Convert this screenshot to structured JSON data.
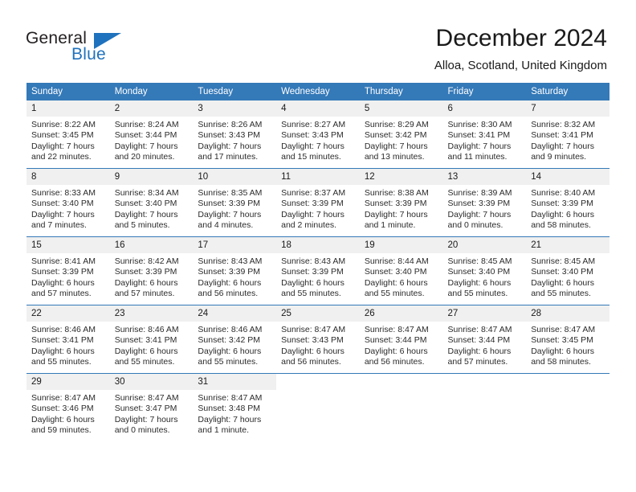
{
  "brand": {
    "name_top": "General",
    "name_bottom": "Blue",
    "triangle_color": "#1f72bd",
    "blue_text_color": "#1f72bd",
    "top_text_color": "#231f20"
  },
  "header": {
    "title": "December 2024",
    "subtitle": "Alloa, Scotland, United Kingdom"
  },
  "colors": {
    "header_row_bg": "#3479b8",
    "header_row_text": "#ffffff",
    "daynum_bg": "#f0f0f0",
    "week_divider": "#3479b8",
    "cell_bg": "#ffffff",
    "body_text": "#2b2b2b"
  },
  "weekday_headers": [
    "Sunday",
    "Monday",
    "Tuesday",
    "Wednesday",
    "Thursday",
    "Friday",
    "Saturday"
  ],
  "weeks": [
    [
      {
        "day": "1",
        "sunrise": "Sunrise: 8:22 AM",
        "sunset": "Sunset: 3:45 PM",
        "daylight_1": "Daylight: 7 hours",
        "daylight_2": "and 22 minutes."
      },
      {
        "day": "2",
        "sunrise": "Sunrise: 8:24 AM",
        "sunset": "Sunset: 3:44 PM",
        "daylight_1": "Daylight: 7 hours",
        "daylight_2": "and 20 minutes."
      },
      {
        "day": "3",
        "sunrise": "Sunrise: 8:26 AM",
        "sunset": "Sunset: 3:43 PM",
        "daylight_1": "Daylight: 7 hours",
        "daylight_2": "and 17 minutes."
      },
      {
        "day": "4",
        "sunrise": "Sunrise: 8:27 AM",
        "sunset": "Sunset: 3:43 PM",
        "daylight_1": "Daylight: 7 hours",
        "daylight_2": "and 15 minutes."
      },
      {
        "day": "5",
        "sunrise": "Sunrise: 8:29 AM",
        "sunset": "Sunset: 3:42 PM",
        "daylight_1": "Daylight: 7 hours",
        "daylight_2": "and 13 minutes."
      },
      {
        "day": "6",
        "sunrise": "Sunrise: 8:30 AM",
        "sunset": "Sunset: 3:41 PM",
        "daylight_1": "Daylight: 7 hours",
        "daylight_2": "and 11 minutes."
      },
      {
        "day": "7",
        "sunrise": "Sunrise: 8:32 AM",
        "sunset": "Sunset: 3:41 PM",
        "daylight_1": "Daylight: 7 hours",
        "daylight_2": "and 9 minutes."
      }
    ],
    [
      {
        "day": "8",
        "sunrise": "Sunrise: 8:33 AM",
        "sunset": "Sunset: 3:40 PM",
        "daylight_1": "Daylight: 7 hours",
        "daylight_2": "and 7 minutes."
      },
      {
        "day": "9",
        "sunrise": "Sunrise: 8:34 AM",
        "sunset": "Sunset: 3:40 PM",
        "daylight_1": "Daylight: 7 hours",
        "daylight_2": "and 5 minutes."
      },
      {
        "day": "10",
        "sunrise": "Sunrise: 8:35 AM",
        "sunset": "Sunset: 3:39 PM",
        "daylight_1": "Daylight: 7 hours",
        "daylight_2": "and 4 minutes."
      },
      {
        "day": "11",
        "sunrise": "Sunrise: 8:37 AM",
        "sunset": "Sunset: 3:39 PM",
        "daylight_1": "Daylight: 7 hours",
        "daylight_2": "and 2 minutes."
      },
      {
        "day": "12",
        "sunrise": "Sunrise: 8:38 AM",
        "sunset": "Sunset: 3:39 PM",
        "daylight_1": "Daylight: 7 hours",
        "daylight_2": "and 1 minute."
      },
      {
        "day": "13",
        "sunrise": "Sunrise: 8:39 AM",
        "sunset": "Sunset: 3:39 PM",
        "daylight_1": "Daylight: 7 hours",
        "daylight_2": "and 0 minutes."
      },
      {
        "day": "14",
        "sunrise": "Sunrise: 8:40 AM",
        "sunset": "Sunset: 3:39 PM",
        "daylight_1": "Daylight: 6 hours",
        "daylight_2": "and 58 minutes."
      }
    ],
    [
      {
        "day": "15",
        "sunrise": "Sunrise: 8:41 AM",
        "sunset": "Sunset: 3:39 PM",
        "daylight_1": "Daylight: 6 hours",
        "daylight_2": "and 57 minutes."
      },
      {
        "day": "16",
        "sunrise": "Sunrise: 8:42 AM",
        "sunset": "Sunset: 3:39 PM",
        "daylight_1": "Daylight: 6 hours",
        "daylight_2": "and 57 minutes."
      },
      {
        "day": "17",
        "sunrise": "Sunrise: 8:43 AM",
        "sunset": "Sunset: 3:39 PM",
        "daylight_1": "Daylight: 6 hours",
        "daylight_2": "and 56 minutes."
      },
      {
        "day": "18",
        "sunrise": "Sunrise: 8:43 AM",
        "sunset": "Sunset: 3:39 PM",
        "daylight_1": "Daylight: 6 hours",
        "daylight_2": "and 55 minutes."
      },
      {
        "day": "19",
        "sunrise": "Sunrise: 8:44 AM",
        "sunset": "Sunset: 3:40 PM",
        "daylight_1": "Daylight: 6 hours",
        "daylight_2": "and 55 minutes."
      },
      {
        "day": "20",
        "sunrise": "Sunrise: 8:45 AM",
        "sunset": "Sunset: 3:40 PM",
        "daylight_1": "Daylight: 6 hours",
        "daylight_2": "and 55 minutes."
      },
      {
        "day": "21",
        "sunrise": "Sunrise: 8:45 AM",
        "sunset": "Sunset: 3:40 PM",
        "daylight_1": "Daylight: 6 hours",
        "daylight_2": "and 55 minutes."
      }
    ],
    [
      {
        "day": "22",
        "sunrise": "Sunrise: 8:46 AM",
        "sunset": "Sunset: 3:41 PM",
        "daylight_1": "Daylight: 6 hours",
        "daylight_2": "and 55 minutes."
      },
      {
        "day": "23",
        "sunrise": "Sunrise: 8:46 AM",
        "sunset": "Sunset: 3:41 PM",
        "daylight_1": "Daylight: 6 hours",
        "daylight_2": "and 55 minutes."
      },
      {
        "day": "24",
        "sunrise": "Sunrise: 8:46 AM",
        "sunset": "Sunset: 3:42 PM",
        "daylight_1": "Daylight: 6 hours",
        "daylight_2": "and 55 minutes."
      },
      {
        "day": "25",
        "sunrise": "Sunrise: 8:47 AM",
        "sunset": "Sunset: 3:43 PM",
        "daylight_1": "Daylight: 6 hours",
        "daylight_2": "and 56 minutes."
      },
      {
        "day": "26",
        "sunrise": "Sunrise: 8:47 AM",
        "sunset": "Sunset: 3:44 PM",
        "daylight_1": "Daylight: 6 hours",
        "daylight_2": "and 56 minutes."
      },
      {
        "day": "27",
        "sunrise": "Sunrise: 8:47 AM",
        "sunset": "Sunset: 3:44 PM",
        "daylight_1": "Daylight: 6 hours",
        "daylight_2": "and 57 minutes."
      },
      {
        "day": "28",
        "sunrise": "Sunrise: 8:47 AM",
        "sunset": "Sunset: 3:45 PM",
        "daylight_1": "Daylight: 6 hours",
        "daylight_2": "and 58 minutes."
      }
    ],
    [
      {
        "day": "29",
        "sunrise": "Sunrise: 8:47 AM",
        "sunset": "Sunset: 3:46 PM",
        "daylight_1": "Daylight: 6 hours",
        "daylight_2": "and 59 minutes."
      },
      {
        "day": "30",
        "sunrise": "Sunrise: 8:47 AM",
        "sunset": "Sunset: 3:47 PM",
        "daylight_1": "Daylight: 7 hours",
        "daylight_2": "and 0 minutes."
      },
      {
        "day": "31",
        "sunrise": "Sunrise: 8:47 AM",
        "sunset": "Sunset: 3:48 PM",
        "daylight_1": "Daylight: 7 hours",
        "daylight_2": "and 1 minute."
      },
      {
        "day": "",
        "sunrise": "",
        "sunset": "",
        "daylight_1": "",
        "daylight_2": ""
      },
      {
        "day": "",
        "sunrise": "",
        "sunset": "",
        "daylight_1": "",
        "daylight_2": ""
      },
      {
        "day": "",
        "sunrise": "",
        "sunset": "",
        "daylight_1": "",
        "daylight_2": ""
      },
      {
        "day": "",
        "sunrise": "",
        "sunset": "",
        "daylight_1": "",
        "daylight_2": ""
      }
    ]
  ]
}
